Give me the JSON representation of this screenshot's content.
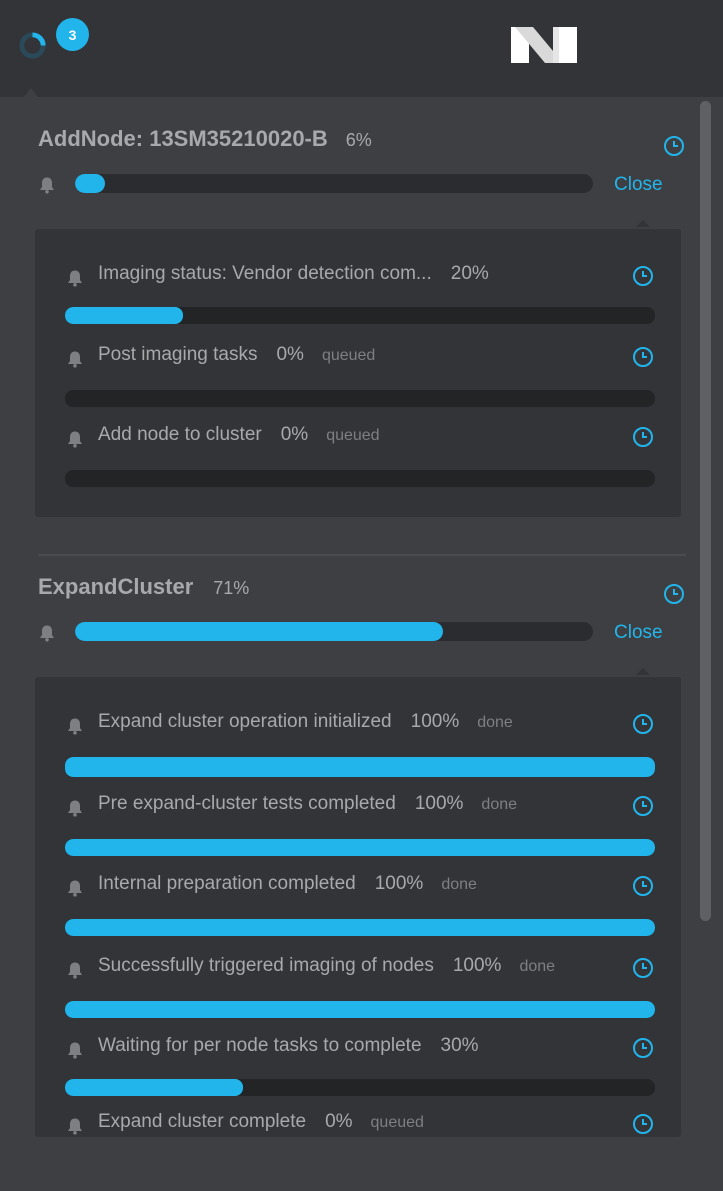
{
  "header": {
    "task_count": "3",
    "logo_icon": "nutanix-logo-icon",
    "spinner_icon": "progress-spinner-icon"
  },
  "colors": {
    "accent": "#22b5ec",
    "panel_bg": "#3e3f42",
    "subpanel_bg": "#333437",
    "text": "#a7a9ad"
  },
  "groups": [
    {
      "title": "AddNode: 13SM35210020-B",
      "percent_text": "6%",
      "progress": 6,
      "close_label": "Close",
      "subtasks": [
        {
          "label": "Imaging status: Vendor detection com...",
          "percent_text": "20%",
          "status": "",
          "progress": 20
        },
        {
          "label": "Post imaging tasks",
          "percent_text": "0%",
          "status": "queued",
          "progress": 0
        },
        {
          "label": "Add node to cluster",
          "percent_text": "0%",
          "status": "queued",
          "progress": 0
        }
      ]
    },
    {
      "title": "ExpandCluster",
      "percent_text": "71%",
      "progress": 71,
      "close_label": "Close",
      "subtasks": [
        {
          "label": "Expand cluster operation initialized",
          "percent_text": "100%",
          "status": "done",
          "progress": 100
        },
        {
          "label": "Pre expand-cluster tests completed",
          "percent_text": "100%",
          "status": "done",
          "progress": 100
        },
        {
          "label": "Internal preparation completed",
          "percent_text": "100%",
          "status": "done",
          "progress": 100
        },
        {
          "label": "Successfully triggered imaging of nodes",
          "percent_text": "100%",
          "status": "done",
          "progress": 100
        },
        {
          "label": "Waiting for per node tasks to complete",
          "percent_text": "30%",
          "status": "",
          "progress": 30
        },
        {
          "label": "Expand cluster complete",
          "percent_text": "0%",
          "status": "queued",
          "progress": 0
        }
      ]
    }
  ]
}
